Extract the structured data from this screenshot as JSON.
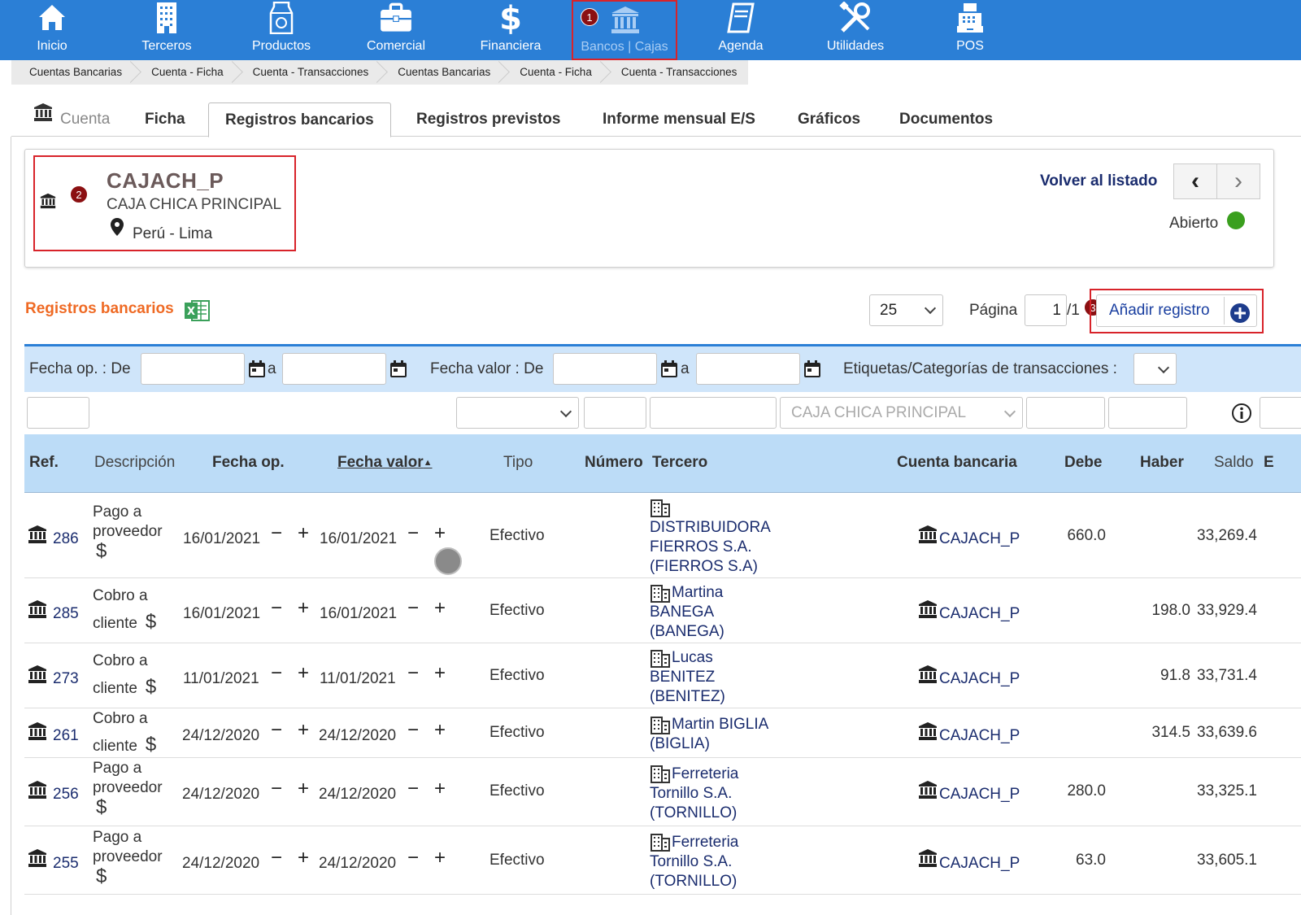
{
  "nav": {
    "items": [
      {
        "label": "Inicio",
        "icon": "home-icon"
      },
      {
        "label": "Terceros",
        "icon": "building-icon"
      },
      {
        "label": "Productos",
        "icon": "milk-carton-icon"
      },
      {
        "label": "Comercial",
        "icon": "briefcase-icon"
      },
      {
        "label": "Financiera",
        "icon": "dollar-icon"
      },
      {
        "label": "Bancos | Cajas",
        "icon": "bank-icon",
        "active": true
      },
      {
        "label": "Agenda",
        "icon": "notebook-icon"
      },
      {
        "label": "Utilidades",
        "icon": "tools-icon"
      },
      {
        "label": "POS",
        "icon": "cash-register-icon"
      }
    ],
    "colors": {
      "bar": "#2b7fd6",
      "highlight": "#d8232a"
    }
  },
  "badges": {
    "one": "1",
    "two": "2",
    "three": "3"
  },
  "breadcrumb": [
    "Cuentas Bancarias",
    "Cuenta - Ficha",
    "Cuenta - Transacciones",
    "Cuentas Bancarias",
    "Cuenta - Ficha",
    "Cuenta - Transacciones"
  ],
  "tabs": {
    "cuenta": "Cuenta",
    "ficha": "Ficha",
    "registros_bancarios": "Registros bancarios",
    "registros_previstos": "Registros previstos",
    "informe": "Informe mensual E/S",
    "graficos": "Gráficos",
    "documentos": "Documentos"
  },
  "account": {
    "code": "CAJACH_P",
    "name": "CAJA CHICA PRINCIPAL",
    "location": "Perú - Lima",
    "back_label": "Volver al listado",
    "status": "Abierto",
    "status_color": "#3a9f1e"
  },
  "list": {
    "title": "Registros bancarios",
    "per_page": "25",
    "page_label": "Página",
    "page": "1",
    "page_total": "/1",
    "add_label": "Añadir registro"
  },
  "filters": {
    "fecha_op": "Fecha op. : De",
    "a1": "a",
    "fecha_valor": "Fecha valor : De",
    "a2": "a",
    "etiquetas": "Etiquetas/Categorías de transacciones :",
    "cuenta_placeholder": "CAJA CHICA PRINCIPAL"
  },
  "columns": {
    "ref": "Ref.",
    "descripcion": "Descripción",
    "fecha_op": "Fecha op.",
    "fecha_valor": "Fecha valor",
    "tipo": "Tipo",
    "numero": "Número",
    "tercero": "Tercero",
    "cuenta": "Cuenta bancaria",
    "debe": "Debe",
    "haber": "Haber",
    "saldo": "Saldo",
    "extra": "E"
  },
  "rows": [
    {
      "ref": "286",
      "desc1": "Pago a",
      "desc2": "proveedor",
      "fecha_op": "16/01/2021",
      "fecha_valor": "16/01/2021",
      "tipo": "Efectivo",
      "tercero1": "DISTRIBUIDORA",
      "tercero2": "FIERROS S.A.",
      "tercero3": "(FIERROS S.A)",
      "cuenta": "CAJACH_P",
      "debe": "660.0",
      "haber": "",
      "saldo": "33,269.4"
    },
    {
      "ref": "285",
      "desc1": "Cobro a",
      "desc2": "cliente",
      "fecha_op": "16/01/2021",
      "fecha_valor": "16/01/2021",
      "tipo": "Efectivo",
      "tercero1": "Martina",
      "tercero2": "BANEGA",
      "tercero3": "(BANEGA)",
      "cuenta": "CAJACH_P",
      "debe": "",
      "haber": "198.0",
      "saldo": "33,929.4"
    },
    {
      "ref": "273",
      "desc1": "Cobro a",
      "desc2": "cliente",
      "fecha_op": "11/01/2021",
      "fecha_valor": "11/01/2021",
      "tipo": "Efectivo",
      "tercero1": "Lucas",
      "tercero2": "BENITEZ",
      "tercero3": "(BENITEZ)",
      "cuenta": "CAJACH_P",
      "debe": "",
      "haber": "91.8",
      "saldo": "33,731.4"
    },
    {
      "ref": "261",
      "desc1": "Cobro a",
      "desc2": "cliente",
      "fecha_op": "24/12/2020",
      "fecha_valor": "24/12/2020",
      "tipo": "Efectivo",
      "tercero1": "Martin BIGLIA",
      "tercero2": "(BIGLIA)",
      "tercero3": "",
      "cuenta": "CAJACH_P",
      "debe": "",
      "haber": "314.5",
      "saldo": "33,639.6"
    },
    {
      "ref": "256",
      "desc1": "Pago a",
      "desc2": "proveedor",
      "fecha_op": "24/12/2020",
      "fecha_valor": "24/12/2020",
      "tipo": "Efectivo",
      "tercero1": "Ferreteria",
      "tercero2": "Tornillo S.A.",
      "tercero3": "(TORNILLO)",
      "cuenta": "CAJACH_P",
      "debe": "280.0",
      "haber": "",
      "saldo": "33,325.1"
    },
    {
      "ref": "255",
      "desc1": "Pago a",
      "desc2": "proveedor",
      "fecha_op": "24/12/2020",
      "fecha_valor": "24/12/2020",
      "tipo": "Efectivo",
      "tercero1": "Ferreteria",
      "tercero2": "Tornillo S.A.",
      "tercero3": "(TORNILLO)",
      "cuenta": "CAJACH_P",
      "debe": "63.0",
      "haber": "",
      "saldo": "33,605.1"
    }
  ],
  "glyphs": {
    "dollar": "$",
    "minus": "−",
    "plus": "+",
    "prev": "‹",
    "next": "›"
  }
}
